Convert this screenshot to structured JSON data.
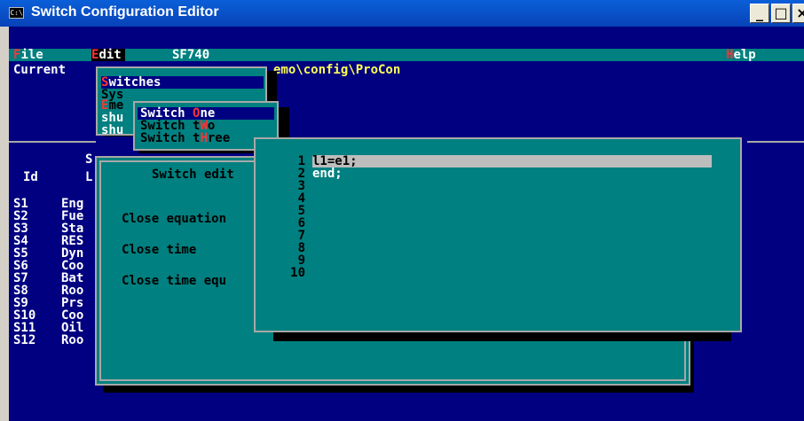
{
  "window": {
    "title": "Switch Configuration Editor",
    "icon_text": "C:\\",
    "buttons": [
      "_",
      "□",
      "×"
    ]
  },
  "menubar": {
    "file_hot": "F",
    "file_rest": "ile",
    "edit_hot": "E",
    "edit_rest": "dit",
    "model": "SF740",
    "help_hot": "H",
    "help_rest": "elp"
  },
  "background": {
    "current_label": "Current",
    "path_fragment": "emo\\config\\ProCon",
    "id_header": "Id",
    "col2_header": "L",
    "s_fragment": "S",
    "rows": [
      {
        "id": "S1",
        "name": "Eng"
      },
      {
        "id": "S2",
        "name": "Fue"
      },
      {
        "id": "S3",
        "name": "Sta"
      },
      {
        "id": "S4",
        "name": "RES"
      },
      {
        "id": "S5",
        "name": "Dyn"
      },
      {
        "id": "S6",
        "name": "Coo"
      },
      {
        "id": "S7",
        "name": "Bat"
      },
      {
        "id": "S8",
        "name": "Roo"
      },
      {
        "id": "S9",
        "name": "Prs"
      },
      {
        "id": "S10",
        "name": "Coo"
      },
      {
        "id": "S11",
        "name": "Oil"
      },
      {
        "id": "S12",
        "name": "Roo"
      }
    ]
  },
  "edit_menu": {
    "switches_hot": "S",
    "switches_rest": "witches",
    "sys": "Sys",
    "eme_hot": "E",
    "eme_rest": "me",
    "shu1": "shu",
    "shu2": "shu"
  },
  "switch_submenu": {
    "one_pre": "Switch ",
    "one_hot": "O",
    "one_post": "ne",
    "two_pre": "Switch t",
    "two_hot": "W",
    "two_post": "o",
    "three_pre": "Switch t",
    "three_hot": "H",
    "three_post": "ree"
  },
  "switch_edit": {
    "title": "Switch edit",
    "close_equation": "Close equation",
    "close_time": "Close time",
    "close_time_equ": "Close time equ",
    "l_fragment": "L"
  },
  "code_editor": {
    "line_numbers": [
      "1",
      "2",
      "3",
      "4",
      "5",
      "6",
      "7",
      "8",
      "9",
      "10"
    ],
    "lines": [
      "l1=e1;",
      "end;"
    ]
  }
}
